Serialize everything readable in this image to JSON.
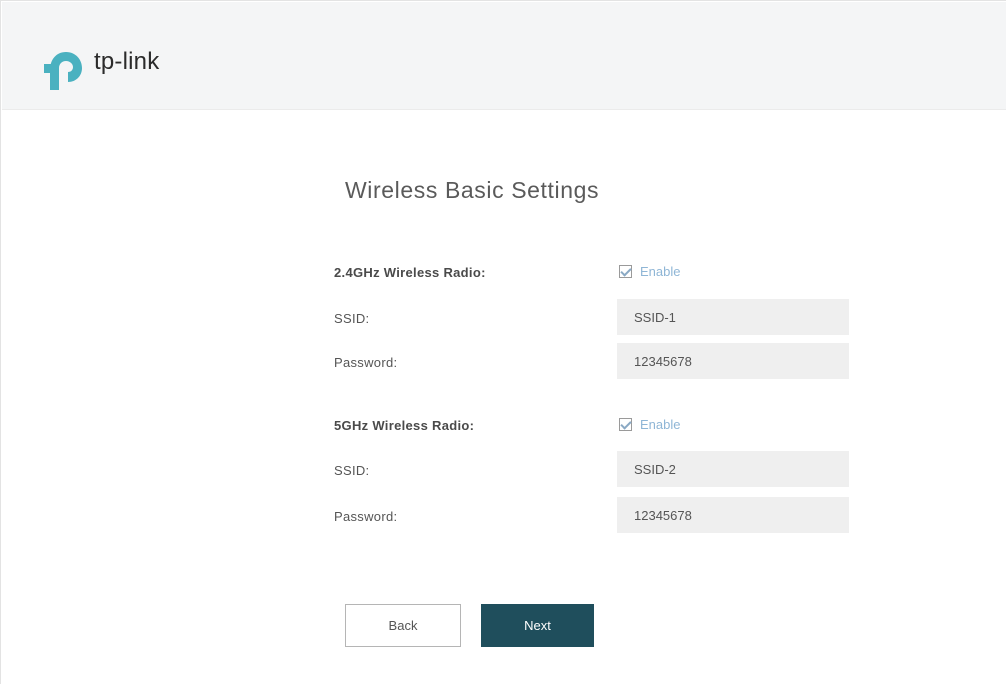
{
  "brand": {
    "logo_text": "tp-link",
    "colors": {
      "teal": "#4ab1c0",
      "header_bg": "#f4f5f6",
      "primary_button": "#1f4e5c",
      "link_blue": "#8fb6d6"
    }
  },
  "page": {
    "title": "Wireless Basic Settings"
  },
  "band_24": {
    "radio_label": "2.4GHz Wireless Radio:",
    "enable_label": "Enable",
    "enabled": true,
    "ssid_label": "SSID:",
    "ssid_value": "SSID-1",
    "password_label": "Password:",
    "password_value": "12345678"
  },
  "band_5": {
    "radio_label": "5GHz Wireless Radio:",
    "enable_label": "Enable",
    "enabled": true,
    "ssid_label": "SSID:",
    "ssid_value": "SSID-2",
    "password_label": "Password:",
    "password_value": "12345678"
  },
  "actions": {
    "back_label": "Back",
    "next_label": "Next"
  }
}
